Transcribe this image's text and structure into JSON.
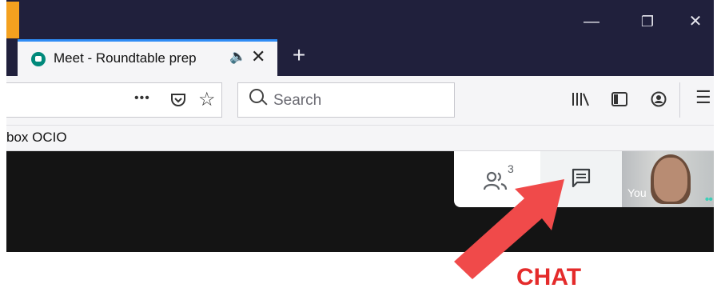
{
  "browser": {
    "window_controls": {
      "minimize": "—",
      "restore": "❐",
      "close": "✕"
    },
    "tab": {
      "title": "Meet - Roundtable prep",
      "audio_icon": "🔈",
      "close": "✕"
    },
    "new_tab": "+",
    "url_actions": {
      "more": "•••",
      "pocket": "pocket-icon",
      "star": "☆"
    },
    "search": {
      "placeholder": "Search"
    },
    "toolbar": {
      "library": "library-icon",
      "sidebar": "sidebar-icon",
      "account": "account-icon",
      "menu": "☰"
    },
    "bookmarks": {
      "label": "box OCIO"
    }
  },
  "meet": {
    "participants_count": "3",
    "self_label": "You",
    "self_dots": "••"
  },
  "annotation": {
    "label": "CHAT",
    "arrow_color": "#f04a4a",
    "label_color": "#e42b2b"
  },
  "colors": {
    "titlebar": "#20203c",
    "tab_accent": "#2f8cf5",
    "meet_accent": "#00897b"
  }
}
